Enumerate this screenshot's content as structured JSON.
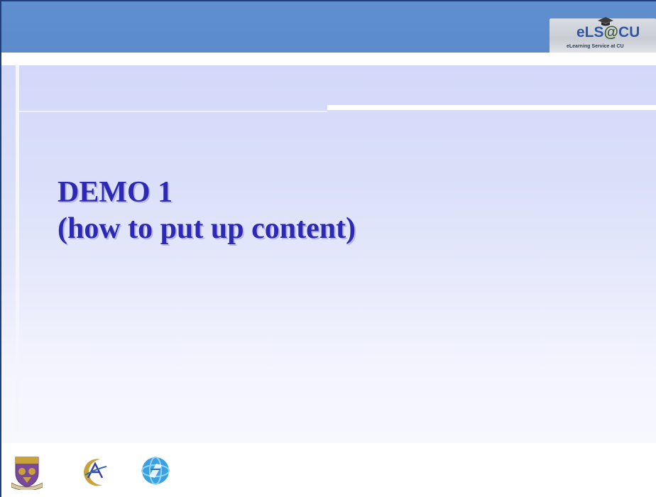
{
  "header": {
    "logo": {
      "text_els": "eLS",
      "text_at": "@",
      "text_cu": "CU",
      "tagline": "eLearning Service at CU",
      "icon": "graduation-cap-icon"
    }
  },
  "slide": {
    "title_line_1": "DEMO 1",
    "title_line_2": "(how to put up content)"
  },
  "footer": {
    "logos": [
      "university-crest-icon",
      "crescent-emblem-icon",
      "globe-emblem-icon"
    ]
  },
  "colors": {
    "header_bar": "#5f8fce",
    "title_text": "#2d28b5",
    "panel_top": "#d3d8fa",
    "panel_bottom": "#f7f8fe",
    "frame_border": "#1f3f7a"
  }
}
